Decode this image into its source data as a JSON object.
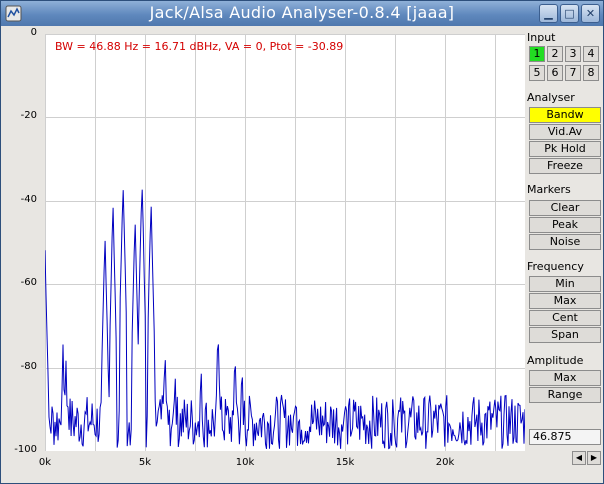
{
  "window": {
    "title": "Jack/Alsa Audio Analyser-0.8.4  [jaaa]",
    "buttons": [
      "minimize",
      "maximize",
      "close"
    ]
  },
  "plot": {
    "info": "BW = 46.88 Hz = 16.71 dBHz, VA = 0, Ptot = -30.89",
    "trace_color": "#0000c0",
    "grid": true
  },
  "chart_data": {
    "type": "line",
    "title": "",
    "xlabel": "",
    "ylabel": "",
    "xlim": [
      0,
      24000
    ],
    "ylim": [
      -100,
      0
    ],
    "x_ticks": [
      "0k",
      "5k",
      "10k",
      "15k",
      "20k"
    ],
    "y_ticks": [
      "0",
      "-20",
      "-40",
      "-60",
      "-80",
      "-100"
    ],
    "noise_floor": -93,
    "peaks": [
      {
        "x": 0,
        "y": -52
      },
      {
        "x": 900,
        "y": -75
      },
      {
        "x": 1050,
        "y": -78
      },
      {
        "x": 3000,
        "y": -48
      },
      {
        "x": 3400,
        "y": -41
      },
      {
        "x": 3900,
        "y": -35
      },
      {
        "x": 4500,
        "y": -43
      },
      {
        "x": 4850,
        "y": -35
      },
      {
        "x": 5300,
        "y": -40
      },
      {
        "x": 6000,
        "y": -76
      },
      {
        "x": 6500,
        "y": -80
      },
      {
        "x": 7800,
        "y": -79
      },
      {
        "x": 8650,
        "y": -70
      },
      {
        "x": 9500,
        "y": -75
      },
      {
        "x": 9850,
        "y": -79
      },
      {
        "x": 12550,
        "y": -84
      },
      {
        "x": 15000,
        "y": -86
      },
      {
        "x": 17400,
        "y": -85
      }
    ]
  },
  "panel": {
    "input": {
      "label": "Input",
      "channels": [
        "1",
        "2",
        "3",
        "4",
        "5",
        "6",
        "7",
        "8"
      ],
      "active": "1"
    },
    "analyser": {
      "label": "Analyser",
      "buttons": [
        "Bandw",
        "Vid.Av",
        "Pk Hold",
        "Freeze"
      ],
      "active": "Bandw"
    },
    "markers": {
      "label": "Markers",
      "buttons": [
        "Clear",
        "Peak",
        "Noise"
      ]
    },
    "frequency": {
      "label": "Frequency",
      "buttons": [
        "Min",
        "Max",
        "Cent",
        "Span"
      ]
    },
    "amplitude": {
      "label": "Amplitude",
      "buttons": [
        "Max",
        "Range"
      ]
    },
    "value": "46.875"
  },
  "colors": {
    "active_channel": "#22dd22",
    "active_mode": "#ffff00",
    "info_text": "#d40000"
  }
}
